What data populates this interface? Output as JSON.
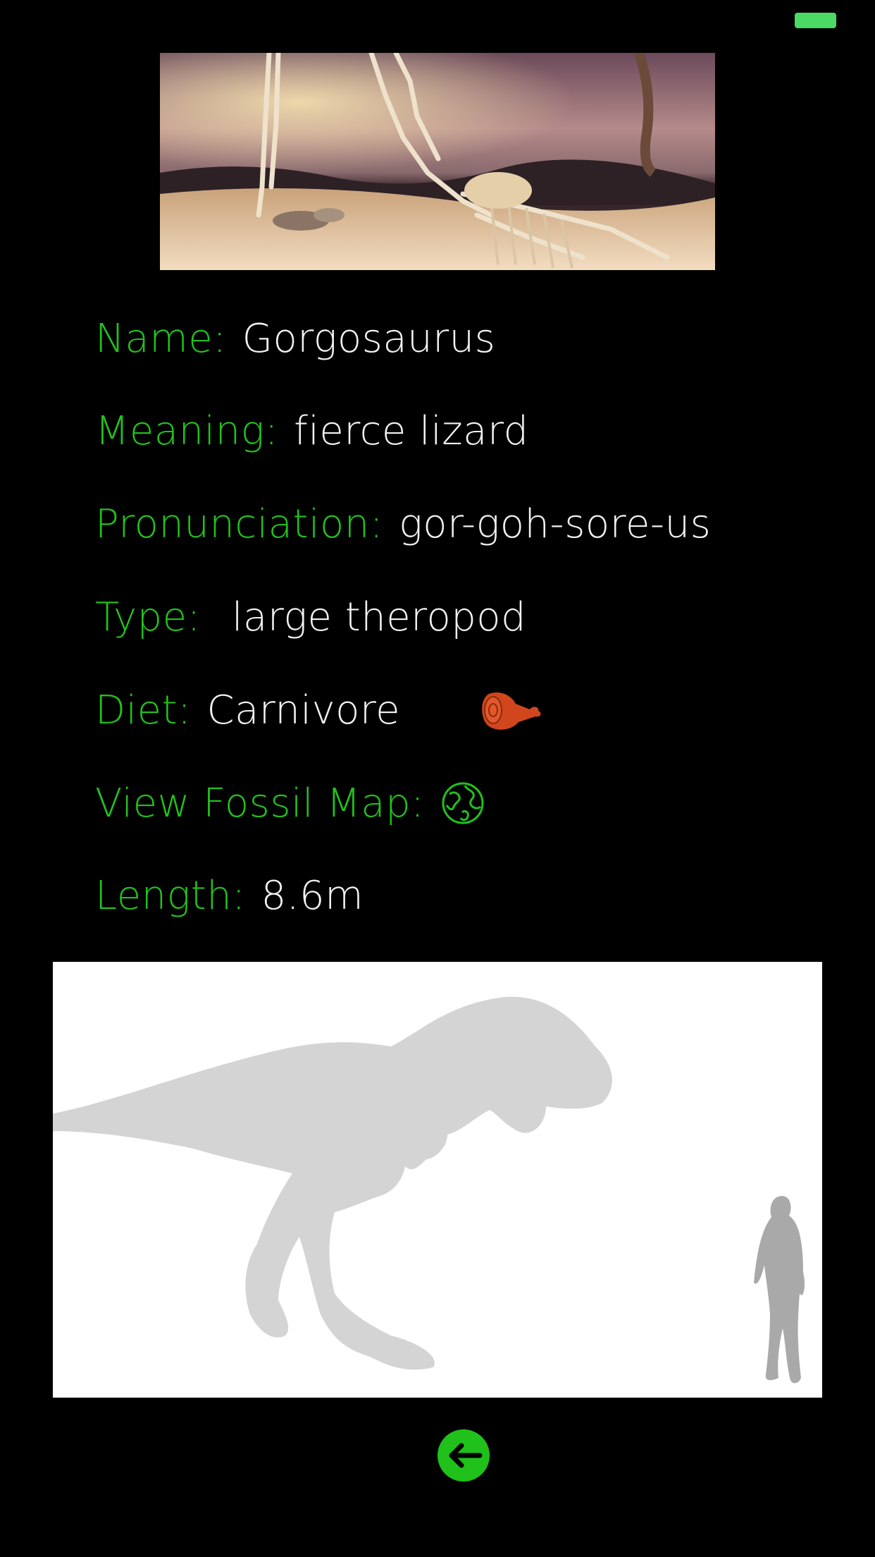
{
  "status": {
    "battery_color": "#4cd964"
  },
  "hero": {
    "image": "dinosaur fossil skeleton museum display"
  },
  "fields": {
    "name_label": "Name:",
    "name_value": "Gorgosaurus",
    "meaning_label": "Meaning:",
    "meaning_value": "fierce lizard",
    "pronunciation_label": "Pronunciation:",
    "pronunciation_value": "gor-goh-sore-us",
    "type_label": "Type:",
    "type_value": "large theropod",
    "diet_label": "Diet:",
    "diet_value": "Carnivore",
    "diet_icon": "meat-icon",
    "map_label": "View Fossil Map:",
    "map_icon": "globe-icon",
    "length_label": "Length:",
    "length_value": "8.6m"
  },
  "size_comparison": {
    "image": "dinosaur and human silhouette size comparison"
  },
  "nav": {
    "back_icon": "arrow-left-icon"
  },
  "colors": {
    "accent": "#22c11d",
    "text": "#f2f2f2",
    "background": "#000000"
  }
}
